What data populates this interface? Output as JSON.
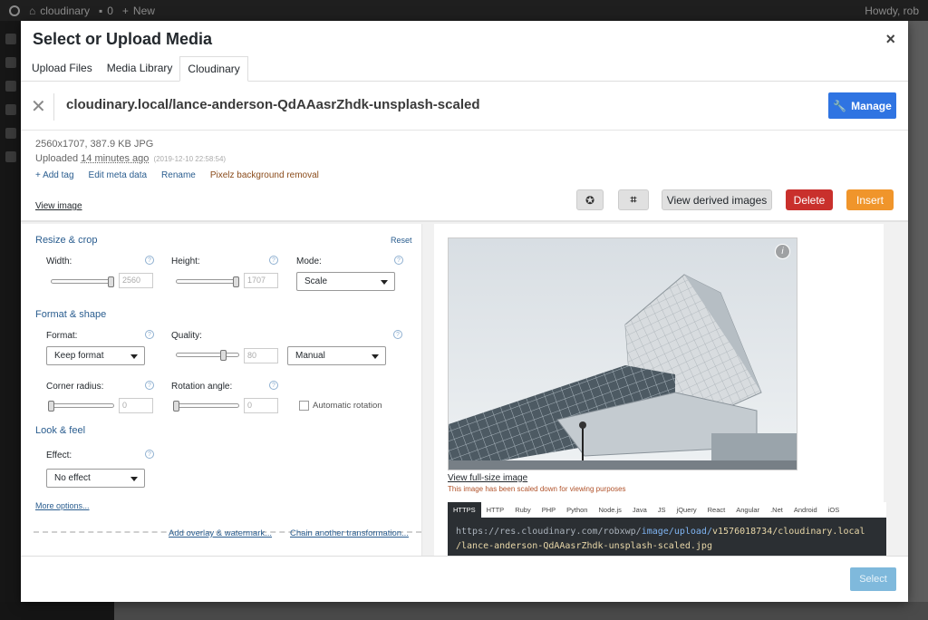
{
  "admin_bar": {
    "site_name": "cloudinary",
    "comments": "0",
    "new_label": "New",
    "howdy": "Howdy, rob"
  },
  "modal": {
    "title": "Select or Upload Media",
    "close": "×"
  },
  "tabs": [
    {
      "label": "Upload Files"
    },
    {
      "label": "Media Library"
    },
    {
      "label": "Cloudinary",
      "active": true
    }
  ],
  "header": {
    "title": "cloudinary.local/lance-anderson-QdAAasrZhdk-unsplash-scaled",
    "manage_label": "Manage"
  },
  "details": {
    "dims": "2560x1707, 387.9 KB JPG",
    "uploaded_label": "Uploaded",
    "uploaded_ago": "14 minutes ago",
    "timestamp": "(2019-12-10 22:58:54)",
    "links": {
      "add_tag": "+ Add tag",
      "edit_meta": "Edit meta data",
      "rename": "Rename",
      "pixelz": "Pixelz background removal"
    },
    "view_image": "View image"
  },
  "actions": {
    "derived": "View derived images",
    "delete": "Delete",
    "insert": "Insert"
  },
  "transform": {
    "resize_title": "Resize & crop",
    "reset": "Reset",
    "width_label": "Width:",
    "width_value": "2560",
    "height_label": "Height:",
    "height_value": "1707",
    "mode_label": "Mode:",
    "mode_value": "Scale",
    "format_title": "Format & shape",
    "format_label": "Format:",
    "format_value": "Keep format",
    "quality_label": "Quality:",
    "quality_value": "80",
    "quality_mode": "Manual",
    "corner_label": "Corner radius:",
    "corner_value": "0",
    "rotation_label": "Rotation angle:",
    "rotation_value": "0",
    "auto_rotation": "Automatic rotation",
    "look_title": "Look & feel",
    "effect_label": "Effect:",
    "effect_value": "No effect",
    "more_options": "More options...",
    "add_overlay": "Add overlay & watermark...",
    "chain": "Chain another transformation...",
    "help": "?"
  },
  "preview": {
    "info": "i",
    "view_full": "View full-size image",
    "scaled_note": "This image has been scaled down for viewing purposes",
    "code_tabs": [
      "HTTPS",
      "HTTP",
      "Ruby",
      "PHP",
      "Python",
      "Node.js",
      "Java",
      "JS",
      "jQuery",
      "React",
      "Angular",
      ".Net",
      "Android",
      "iOS"
    ],
    "url_prefix": "https://res.cloudinary.com/robxwp/",
    "url_highlight": "image/upload/",
    "url_rest_1": "v1576018734/cloudinary.local",
    "url_rest_2": "/lance-anderson-QdAAasrZhdk-unsplash-scaled.jpg"
  },
  "footer": {
    "select_label": "Select"
  }
}
